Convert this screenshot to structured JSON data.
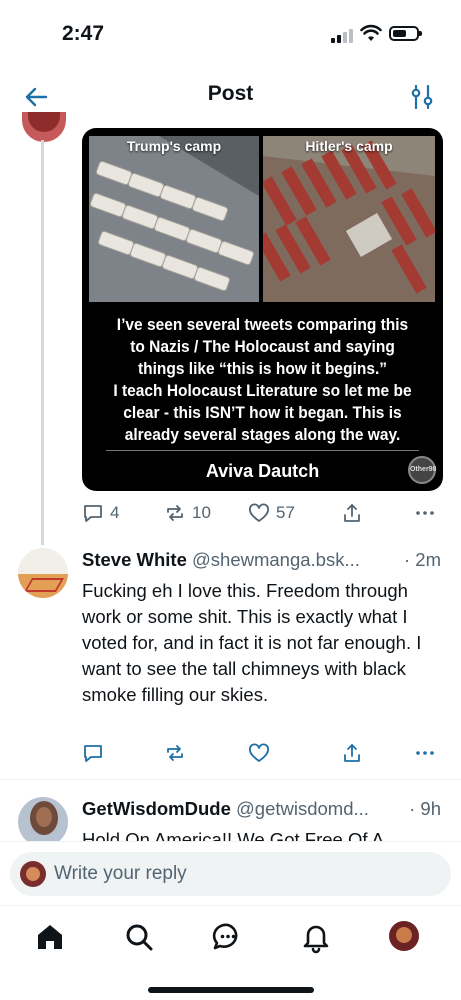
{
  "status_bar": {
    "time": "2:47",
    "signal_icon": "cellular-signal-icon",
    "wifi_icon": "wifi-icon",
    "battery_icon": "battery-icon"
  },
  "header": {
    "title": "Post",
    "back_icon": "arrow-left-icon",
    "settings_icon": "sliders-icon"
  },
  "main_post": {
    "image": {
      "left_label": "Trump's camp",
      "right_label": "Hitler's camp",
      "quote_lines": [
        "I’ve seen several tweets comparing this",
        "to Nazis / The Holocaust and saying",
        "things like “this is how it begins.”",
        "I teach Holocaust Literature so let me be",
        "clear - this ISN’T how it began. This is",
        "already several stages along the way."
      ],
      "author": "Aviva Dautch",
      "seal_text": "Other98"
    },
    "actions": {
      "reply_count": "4",
      "repost_count": "10",
      "like_count": "57"
    }
  },
  "replies": [
    {
      "name": "Steve White",
      "handle": "@shewmanga.bsk...",
      "time": "· 2m",
      "text": "Fucking eh I love this. Freedom through work or some shit. This is exactly what I voted for, and  in fact it is not far enough. I want to see the tall chimneys with black smoke filling our skies."
    },
    {
      "name": "GetWisdomDude",
      "handle": "@getwisdomd...",
      "time": "· 9h",
      "text": "Hold On America!! We Got Free Of A"
    }
  ],
  "composer": {
    "placeholder": "Write your reply"
  },
  "tabbar": {
    "icons": [
      "home-icon",
      "search-icon",
      "chat-icon",
      "bell-icon",
      "profile-avatar"
    ]
  },
  "colors": {
    "text": "#0f1419",
    "muted": "#536471",
    "accent": "#1d9bf0",
    "divider": "#eff3f4"
  }
}
